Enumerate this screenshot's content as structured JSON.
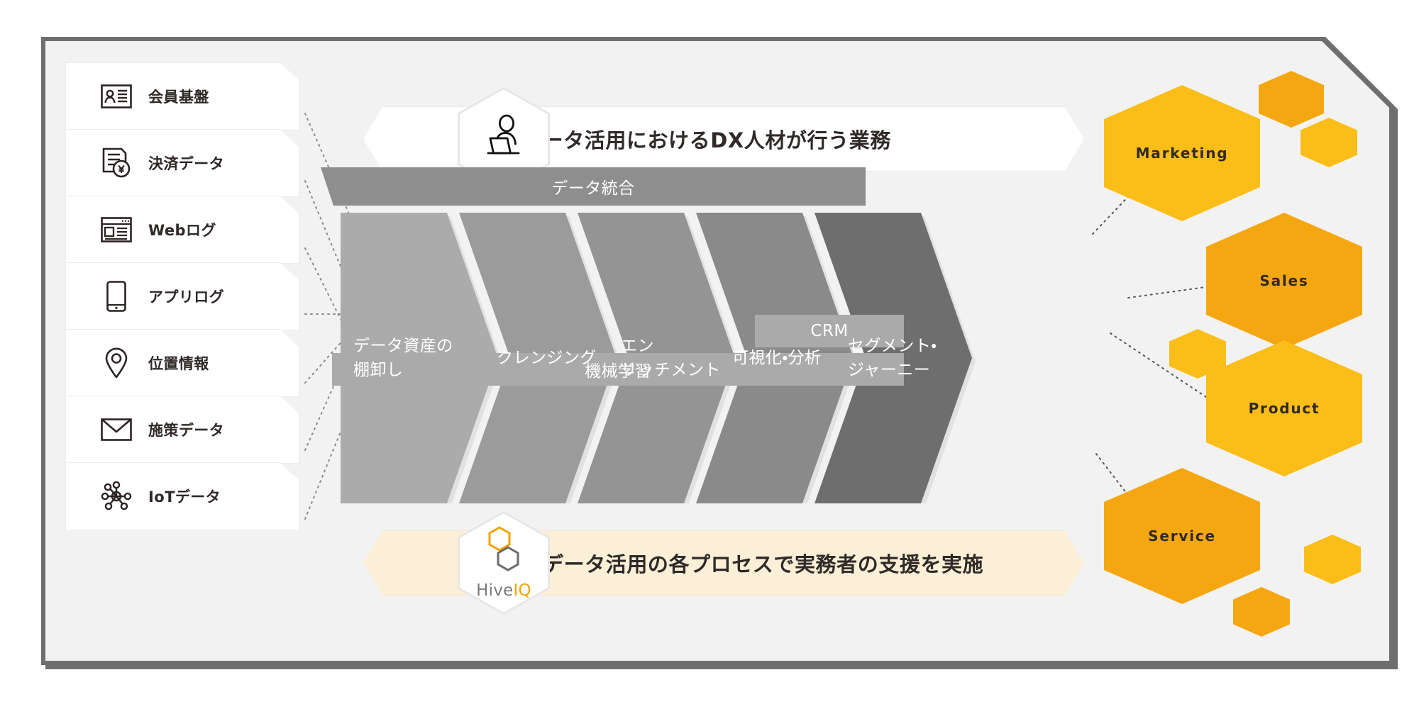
{
  "diagram": {
    "title_banner": {
      "text": "データ活用におけるDX人材が行う業務",
      "icon": "person-at-laptop-icon"
    },
    "footer_banner": {
      "text": "データ活用の各プロセスで実務者の支援を実施",
      "logo_name": "Hive",
      "logo_accent": "IQ",
      "icon": "hiveiq-hexagon-logo"
    },
    "sources": {
      "items": [
        {
          "label": "会員基盤",
          "icon": "member-card-icon"
        },
        {
          "label": "決済データ",
          "icon": "payment-yen-document-icon"
        },
        {
          "label": "Webログ",
          "icon": "browser-window-icon"
        },
        {
          "label": "アプリログ",
          "icon": "smartphone-icon"
        },
        {
          "label": "位置情報",
          "icon": "map-pin-icon"
        },
        {
          "label": "施策データ",
          "icon": "envelope-icon"
        },
        {
          "label": "IoTデータ",
          "icon": "iot-network-icon"
        }
      ]
    },
    "pipeline": {
      "top_strip": {
        "label": "データ統合"
      },
      "steps": [
        {
          "label": "データ資産の\n棚卸し",
          "color": "#ababab"
        },
        {
          "label": "クレンジング",
          "color": "#9b9b9b"
        },
        {
          "label": "エン\nリッチメント",
          "color": "#949494"
        },
        {
          "label": "可視化・分析",
          "color": "#8a8a8a"
        },
        {
          "label": "セグメント・\nジャーニー",
          "color": "#6e6e6e"
        }
      ],
      "bottom_strips": [
        {
          "label": "CRM",
          "color": "#abaaaa"
        },
        {
          "label": "機械学習",
          "color": "#abaaaa"
        }
      ]
    },
    "audiences": {
      "items": [
        {
          "label": "Marketing",
          "color": "#fbbe18"
        },
        {
          "label": "Sales",
          "color": "#f5a712"
        },
        {
          "label": "Product",
          "color": "#fbbe18"
        },
        {
          "label": "Service",
          "color": "#f5a712"
        }
      ]
    },
    "decor_hexagons": [
      {
        "color": "#f5a712"
      },
      {
        "color": "#fbbe18"
      },
      {
        "color": "#fbbe18"
      },
      {
        "color": "#f5a712"
      },
      {
        "color": "#fbbe18"
      },
      {
        "color": "#f5a712"
      }
    ],
    "colors": {
      "frame_border": "#6e6e6e",
      "frame_bg": "#f2f2f2",
      "card_bg": "#ffffff",
      "accent_yellow": "#fbbe18",
      "accent_orange": "#f5a712",
      "banner_cream": "#fbf0d7",
      "text_dark": "#2f2a28"
    }
  }
}
